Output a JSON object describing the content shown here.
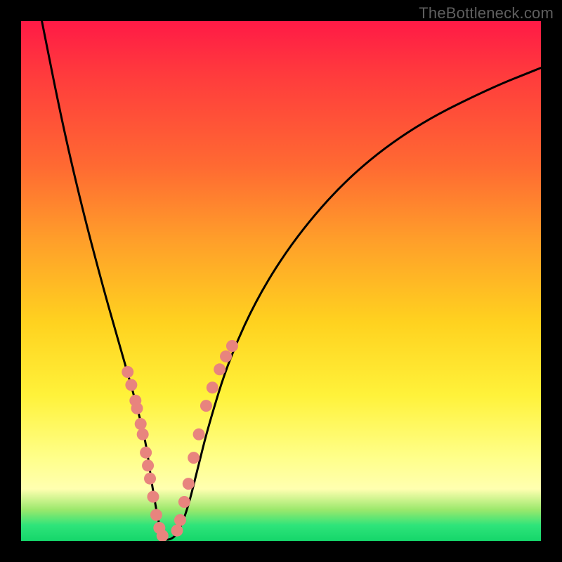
{
  "watermark": "TheBottleneck.com",
  "chart_data": {
    "type": "line",
    "title": "",
    "xlabel": "",
    "ylabel": "",
    "xlim": [
      0,
      100
    ],
    "ylim": [
      0,
      100
    ],
    "series": [
      {
        "name": "curve",
        "x": [
          4,
          8,
          12,
          16,
          18,
          20,
          22,
          24,
          25,
          26,
          27,
          28,
          30,
          32,
          34,
          36,
          40,
          46,
          54,
          64,
          76,
          90,
          100
        ],
        "y": [
          100,
          80,
          63,
          48,
          41,
          34,
          27,
          19,
          12,
          6,
          1,
          0,
          1,
          6,
          14,
          22,
          35,
          48,
          60,
          71,
          80,
          87,
          91
        ]
      }
    ],
    "highlight_left": {
      "name": "left-dots",
      "x": [
        20.5,
        21.2,
        22.0,
        22.3,
        23.0,
        23.4,
        24.0,
        24.4,
        24.8,
        25.4,
        26.0,
        26.6,
        27.2
      ],
      "y": [
        32.5,
        30.0,
        27.0,
        25.5,
        22.5,
        20.5,
        17.0,
        14.5,
        12.0,
        8.5,
        5.0,
        2.5,
        1.0
      ]
    },
    "highlight_right": {
      "name": "right-dots",
      "x": [
        30.0,
        30.6,
        31.4,
        32.2,
        33.2,
        34.2,
        35.6,
        36.8,
        38.2,
        39.4,
        40.6
      ],
      "y": [
        2.0,
        4.0,
        7.5,
        11.0,
        16.0,
        20.5,
        26.0,
        29.5,
        33.0,
        35.5,
        37.5
      ]
    },
    "colors": {
      "curve": "#000000",
      "dots": "#e8847e",
      "background_top": "#ff1a46",
      "background_bottom": "#15d66a"
    }
  }
}
